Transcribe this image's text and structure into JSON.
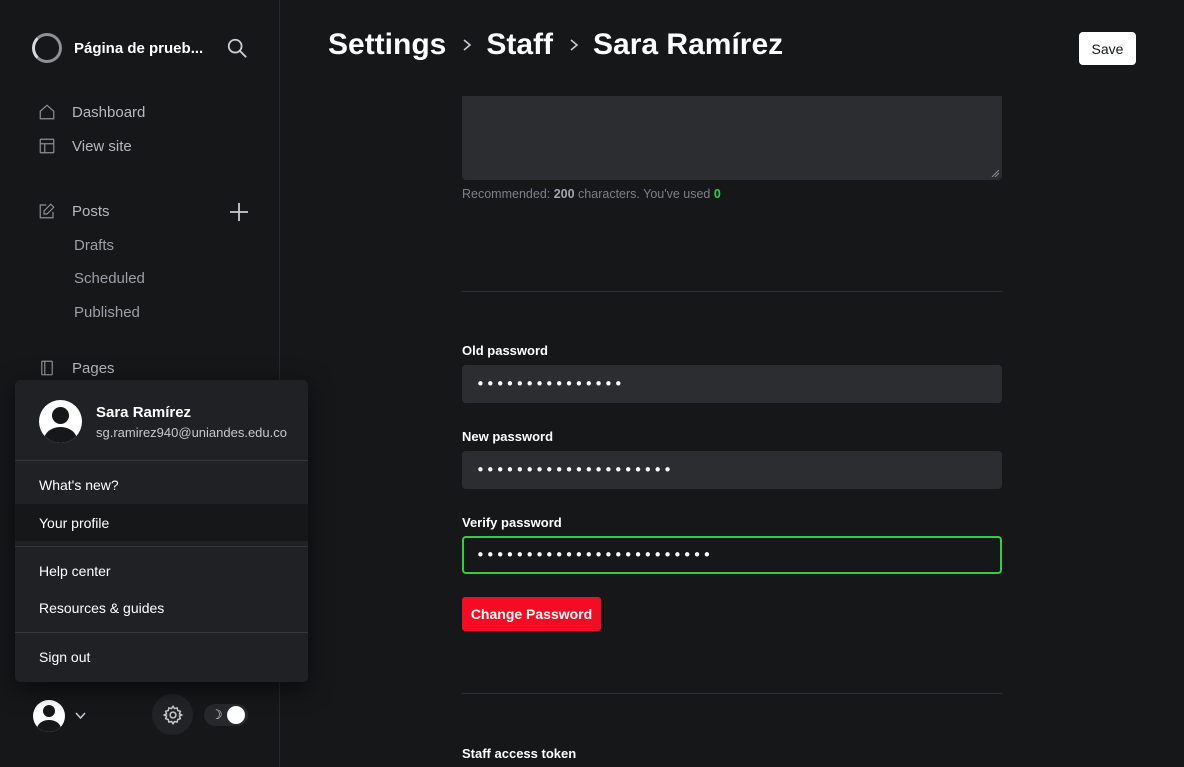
{
  "sidebar": {
    "site_title": "Página de prueb...",
    "nav": [
      {
        "label": "Dashboard",
        "icon": "home-icon"
      },
      {
        "label": "View site",
        "icon": "layout-icon"
      },
      {
        "label": "Posts",
        "icon": "pencil-icon"
      },
      {
        "label": "Pages",
        "icon": "pages-icon"
      }
    ],
    "posts_sub": [
      "Drafts",
      "Scheduled",
      "Published"
    ]
  },
  "user_menu": {
    "name": "Sara Ramírez",
    "email": "sg.ramirez940@uniandes.edu.co",
    "items": [
      "What's new?",
      "Your profile",
      "Help center",
      "Resources & guides",
      "Sign out"
    ],
    "active_item": "Your profile"
  },
  "header": {
    "breadcrumbs": [
      "Settings",
      "Staff",
      "Sara Ramírez"
    ],
    "save_label": "Save"
  },
  "bio": {
    "hint_prefix": "Recommended: ",
    "hint_limit": "200",
    "hint_middle": " characters. You've used ",
    "hint_used": "0"
  },
  "password": {
    "old_label": "Old password",
    "old_value": "•••••••••••••••",
    "new_label": "New password",
    "new_value": "••••••••••••••••••••",
    "verify_label": "Verify password",
    "verify_value": "••••••••••••••••••••••••",
    "change_button": "Change Password"
  },
  "token": {
    "label": "Staff access token"
  },
  "colors": {
    "accent_green": "#30cf43",
    "danger_red": "#f50b23",
    "background": "#151719"
  }
}
